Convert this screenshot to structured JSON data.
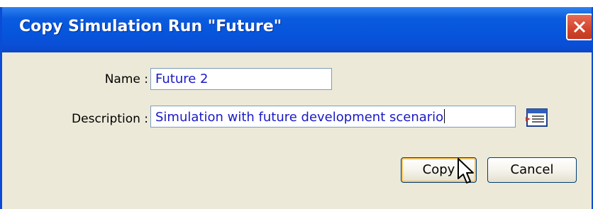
{
  "dialog": {
    "title": "Copy Simulation Run \"Future\"",
    "close_icon": "close-icon"
  },
  "form": {
    "name_label": "Name :",
    "name_value": "Future 2",
    "description_label": "Description :",
    "description_value": "Simulation with future development scenario",
    "description_editor_icon": "text-editor-icon"
  },
  "buttons": {
    "copy_label": "Copy",
    "cancel_label": "Cancel"
  },
  "colors": {
    "title_bar": "#0655dc",
    "dialog_background": "#ece9d8",
    "input_text": "#1a1ac8",
    "close_button": "#d2452b",
    "default_button_focus": "#f7c25c"
  }
}
